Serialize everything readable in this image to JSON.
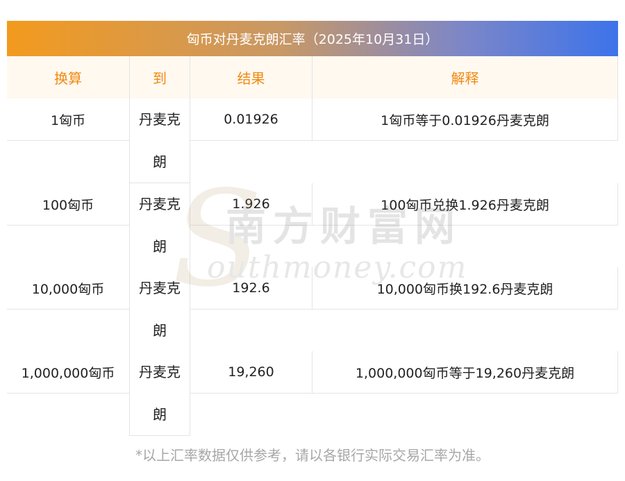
{
  "title": "匈币对丹麦克朗汇率（2025年10月31日）",
  "headers": [
    "换算",
    "到",
    "结果",
    "解释"
  ],
  "rows": [
    {
      "amount": "1匈币",
      "to": "丹麦克朗",
      "result": "0.01926",
      "explain": "1匈币等于0.01926丹麦克朗"
    },
    {
      "amount": "100匈币",
      "to": "丹麦克朗",
      "result": "1.926",
      "explain": "100匈币兑换1.926丹麦克朗"
    },
    {
      "amount": "10,000匈币",
      "to": "丹麦克朗",
      "result": "192.6",
      "explain": "10,000匈币换192.6丹麦克朗"
    },
    {
      "amount": "1,000,000匈币",
      "to": "丹麦克朗",
      "result": "19,260",
      "explain": "1,000,000匈币等于19,260丹麦克朗"
    }
  ],
  "note": "*以上汇率数据仅供参考，请以各银行实际交易汇率为准。",
  "watermark": {
    "cn": "南方财富网",
    "en": "outhmoney.com",
    "initial": "S"
  },
  "colors": {
    "header_text": "#f08a12",
    "header_bg": "#fff9f0",
    "title_start": "#f39a1e",
    "title_end": "#3d73ea"
  }
}
